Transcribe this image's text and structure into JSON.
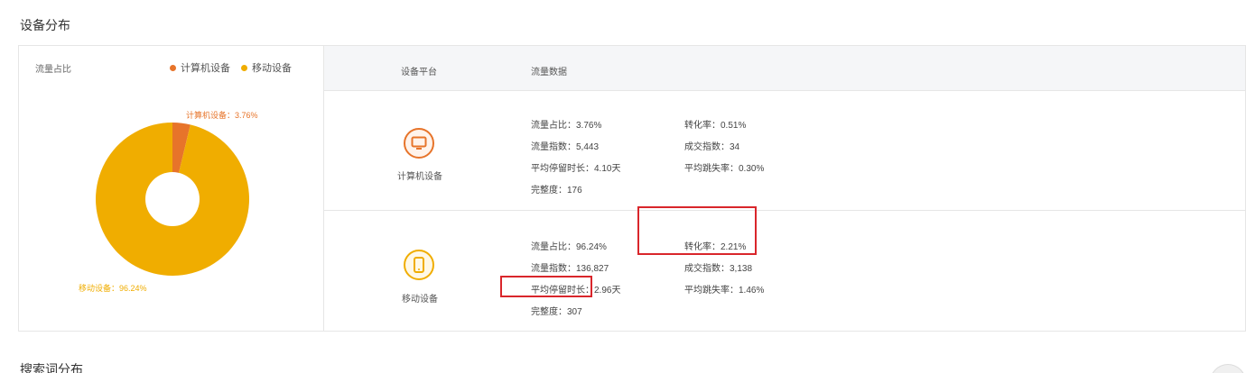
{
  "page": {
    "section_title": "设备分布",
    "bottom_section_title": "搜索词分布"
  },
  "chart_data": {
    "type": "pie",
    "title": "",
    "label": "流量占比",
    "categories": [
      "计算机设备",
      "移动设备"
    ],
    "values": [
      3.76,
      96.24
    ],
    "colors": [
      "#e7742a",
      "#f0ad00"
    ],
    "slice_labels": [
      "计算机设备：3.76%",
      "移动设备：96.24%"
    ],
    "legend_placement": "top-right"
  },
  "table": {
    "headers": {
      "type": "设备平台",
      "data": "流量数据"
    },
    "rows": [
      {
        "device": "计算机设备",
        "icon": "monitor-icon",
        "metrics": [
          "流量占比：3.76%",
          "转化率：0.51%",
          "流量指数：5,443",
          "成交指数：34",
          "平均停留时长：4.10天",
          "平均跳失率：0.30%",
          "完整度：176"
        ]
      },
      {
        "device": "移动设备",
        "icon": "phone-icon",
        "metrics": [
          "流量占比：96.24%",
          "转化率：2.21%",
          "流量指数：136,827",
          "成交指数：3,138",
          "平均停留时长：2.96天",
          "平均跳失率：1.46%",
          "完整度：307"
        ]
      }
    ]
  },
  "colors": {
    "computer": "#e7742a",
    "mobile": "#f0ad00",
    "highlight": "#d9262b"
  }
}
